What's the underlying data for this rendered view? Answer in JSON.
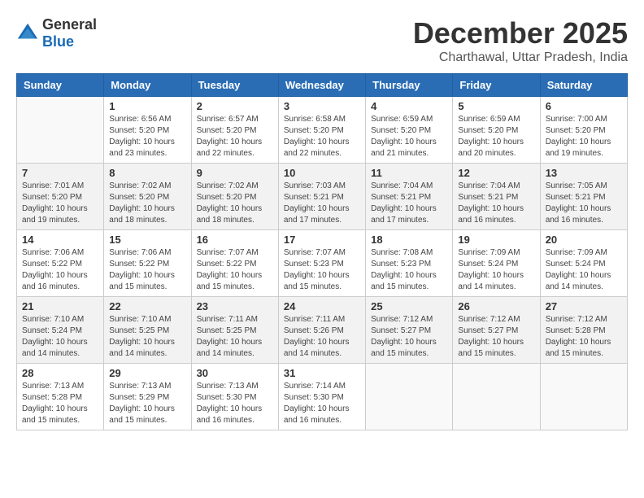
{
  "logo": {
    "text_general": "General",
    "text_blue": "Blue"
  },
  "header": {
    "month": "December 2025",
    "location": "Charthawal, Uttar Pradesh, India"
  },
  "days_of_week": [
    "Sunday",
    "Monday",
    "Tuesday",
    "Wednesday",
    "Thursday",
    "Friday",
    "Saturday"
  ],
  "weeks": [
    [
      {
        "day": "",
        "sunrise": "",
        "sunset": "",
        "daylight": ""
      },
      {
        "day": "1",
        "sunrise": "Sunrise: 6:56 AM",
        "sunset": "Sunset: 5:20 PM",
        "daylight": "Daylight: 10 hours and 23 minutes."
      },
      {
        "day": "2",
        "sunrise": "Sunrise: 6:57 AM",
        "sunset": "Sunset: 5:20 PM",
        "daylight": "Daylight: 10 hours and 22 minutes."
      },
      {
        "day": "3",
        "sunrise": "Sunrise: 6:58 AM",
        "sunset": "Sunset: 5:20 PM",
        "daylight": "Daylight: 10 hours and 22 minutes."
      },
      {
        "day": "4",
        "sunrise": "Sunrise: 6:59 AM",
        "sunset": "Sunset: 5:20 PM",
        "daylight": "Daylight: 10 hours and 21 minutes."
      },
      {
        "day": "5",
        "sunrise": "Sunrise: 6:59 AM",
        "sunset": "Sunset: 5:20 PM",
        "daylight": "Daylight: 10 hours and 20 minutes."
      },
      {
        "day": "6",
        "sunrise": "Sunrise: 7:00 AM",
        "sunset": "Sunset: 5:20 PM",
        "daylight": "Daylight: 10 hours and 19 minutes."
      }
    ],
    [
      {
        "day": "7",
        "sunrise": "Sunrise: 7:01 AM",
        "sunset": "Sunset: 5:20 PM",
        "daylight": "Daylight: 10 hours and 19 minutes."
      },
      {
        "day": "8",
        "sunrise": "Sunrise: 7:02 AM",
        "sunset": "Sunset: 5:20 PM",
        "daylight": "Daylight: 10 hours and 18 minutes."
      },
      {
        "day": "9",
        "sunrise": "Sunrise: 7:02 AM",
        "sunset": "Sunset: 5:20 PM",
        "daylight": "Daylight: 10 hours and 18 minutes."
      },
      {
        "day": "10",
        "sunrise": "Sunrise: 7:03 AM",
        "sunset": "Sunset: 5:21 PM",
        "daylight": "Daylight: 10 hours and 17 minutes."
      },
      {
        "day": "11",
        "sunrise": "Sunrise: 7:04 AM",
        "sunset": "Sunset: 5:21 PM",
        "daylight": "Daylight: 10 hours and 17 minutes."
      },
      {
        "day": "12",
        "sunrise": "Sunrise: 7:04 AM",
        "sunset": "Sunset: 5:21 PM",
        "daylight": "Daylight: 10 hours and 16 minutes."
      },
      {
        "day": "13",
        "sunrise": "Sunrise: 7:05 AM",
        "sunset": "Sunset: 5:21 PM",
        "daylight": "Daylight: 10 hours and 16 minutes."
      }
    ],
    [
      {
        "day": "14",
        "sunrise": "Sunrise: 7:06 AM",
        "sunset": "Sunset: 5:22 PM",
        "daylight": "Daylight: 10 hours and 16 minutes."
      },
      {
        "day": "15",
        "sunrise": "Sunrise: 7:06 AM",
        "sunset": "Sunset: 5:22 PM",
        "daylight": "Daylight: 10 hours and 15 minutes."
      },
      {
        "day": "16",
        "sunrise": "Sunrise: 7:07 AM",
        "sunset": "Sunset: 5:22 PM",
        "daylight": "Daylight: 10 hours and 15 minutes."
      },
      {
        "day": "17",
        "sunrise": "Sunrise: 7:07 AM",
        "sunset": "Sunset: 5:23 PM",
        "daylight": "Daylight: 10 hours and 15 minutes."
      },
      {
        "day": "18",
        "sunrise": "Sunrise: 7:08 AM",
        "sunset": "Sunset: 5:23 PM",
        "daylight": "Daylight: 10 hours and 15 minutes."
      },
      {
        "day": "19",
        "sunrise": "Sunrise: 7:09 AM",
        "sunset": "Sunset: 5:24 PM",
        "daylight": "Daylight: 10 hours and 14 minutes."
      },
      {
        "day": "20",
        "sunrise": "Sunrise: 7:09 AM",
        "sunset": "Sunset: 5:24 PM",
        "daylight": "Daylight: 10 hours and 14 minutes."
      }
    ],
    [
      {
        "day": "21",
        "sunrise": "Sunrise: 7:10 AM",
        "sunset": "Sunset: 5:24 PM",
        "daylight": "Daylight: 10 hours and 14 minutes."
      },
      {
        "day": "22",
        "sunrise": "Sunrise: 7:10 AM",
        "sunset": "Sunset: 5:25 PM",
        "daylight": "Daylight: 10 hours and 14 minutes."
      },
      {
        "day": "23",
        "sunrise": "Sunrise: 7:11 AM",
        "sunset": "Sunset: 5:25 PM",
        "daylight": "Daylight: 10 hours and 14 minutes."
      },
      {
        "day": "24",
        "sunrise": "Sunrise: 7:11 AM",
        "sunset": "Sunset: 5:26 PM",
        "daylight": "Daylight: 10 hours and 14 minutes."
      },
      {
        "day": "25",
        "sunrise": "Sunrise: 7:12 AM",
        "sunset": "Sunset: 5:27 PM",
        "daylight": "Daylight: 10 hours and 15 minutes."
      },
      {
        "day": "26",
        "sunrise": "Sunrise: 7:12 AM",
        "sunset": "Sunset: 5:27 PM",
        "daylight": "Daylight: 10 hours and 15 minutes."
      },
      {
        "day": "27",
        "sunrise": "Sunrise: 7:12 AM",
        "sunset": "Sunset: 5:28 PM",
        "daylight": "Daylight: 10 hours and 15 minutes."
      }
    ],
    [
      {
        "day": "28",
        "sunrise": "Sunrise: 7:13 AM",
        "sunset": "Sunset: 5:28 PM",
        "daylight": "Daylight: 10 hours and 15 minutes."
      },
      {
        "day": "29",
        "sunrise": "Sunrise: 7:13 AM",
        "sunset": "Sunset: 5:29 PM",
        "daylight": "Daylight: 10 hours and 15 minutes."
      },
      {
        "day": "30",
        "sunrise": "Sunrise: 7:13 AM",
        "sunset": "Sunset: 5:30 PM",
        "daylight": "Daylight: 10 hours and 16 minutes."
      },
      {
        "day": "31",
        "sunrise": "Sunrise: 7:14 AM",
        "sunset": "Sunset: 5:30 PM",
        "daylight": "Daylight: 10 hours and 16 minutes."
      },
      {
        "day": "",
        "sunrise": "",
        "sunset": "",
        "daylight": ""
      },
      {
        "day": "",
        "sunrise": "",
        "sunset": "",
        "daylight": ""
      },
      {
        "day": "",
        "sunrise": "",
        "sunset": "",
        "daylight": ""
      }
    ]
  ]
}
